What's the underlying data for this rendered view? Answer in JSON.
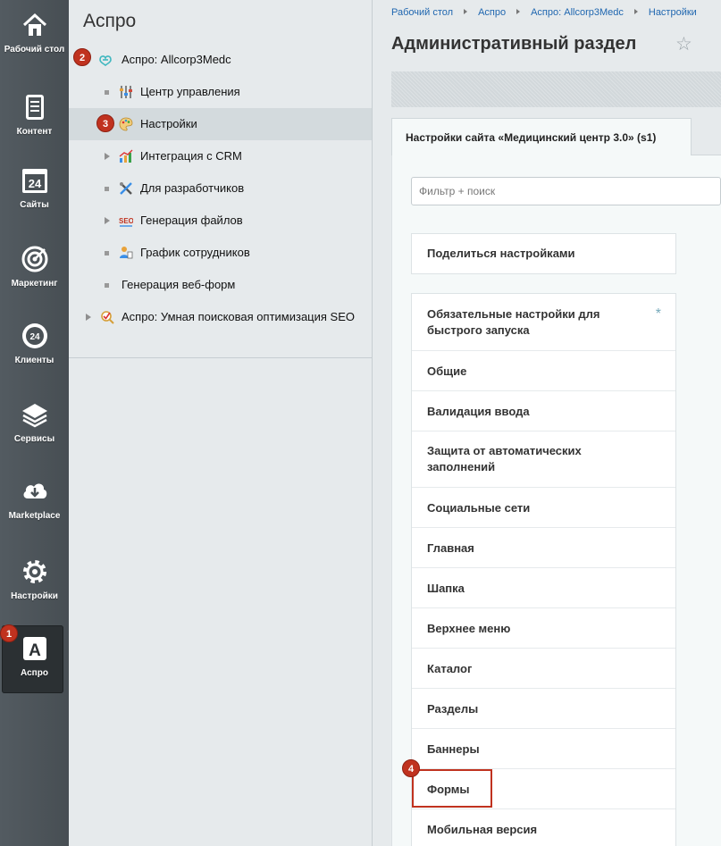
{
  "rail": {
    "items": [
      {
        "label": "Рабочий стол",
        "icon": "home-icon"
      },
      {
        "label": "Контент",
        "icon": "document-icon"
      },
      {
        "label": "Сайты",
        "icon": "calendar-24-icon"
      },
      {
        "label": "Маркетинг",
        "icon": "target-icon"
      },
      {
        "label": "Клиенты",
        "icon": "clients-24-icon"
      },
      {
        "label": "Сервисы",
        "icon": "layers-icon"
      },
      {
        "label": "Marketplace",
        "icon": "cloud-download-icon"
      },
      {
        "label": "Настройки",
        "icon": "gear-icon"
      },
      {
        "label": "Аспро",
        "icon": "aspro-a-icon",
        "active": true
      }
    ]
  },
  "badges": {
    "b1": "1",
    "b2": "2",
    "b3": "3",
    "b4": "4"
  },
  "tree": {
    "title": "Аспро",
    "items": [
      {
        "label": "Аспро: Allcorp3Medc",
        "icon": "heart-link-icon"
      },
      {
        "label": "Центр управления",
        "icon": "sliders-icon"
      },
      {
        "label": "Настройки",
        "icon": "palette-icon",
        "selected": true
      },
      {
        "label": "Интеграция с CRM",
        "icon": "crm-chart-icon"
      },
      {
        "label": "Для разработчиков",
        "icon": "tools-icon"
      },
      {
        "label": "Генерация файлов",
        "icon": "seo-icon"
      },
      {
        "label": "График сотрудников",
        "icon": "employee-schedule-icon"
      },
      {
        "label": "Генерация веб-форм"
      },
      {
        "label": "Аспро: Умная поисковая оптимизация SEO",
        "icon": "magnifier-check-icon"
      }
    ]
  },
  "breadcrumb": [
    "Рабочий стол",
    "Аспро",
    "Аспро: Allcorp3Medc",
    "Настройки"
  ],
  "page_title": "Административный раздел",
  "tab_label": "Настройки сайта «Медицинский центр 3.0» (s1)",
  "filter": {
    "placeholder": "Фильтр + поиск"
  },
  "share_label": "Поделиться настройками",
  "menu": [
    "Обязательные настройки для быстрого запуска",
    "Общие",
    "Валидация ввода",
    "Защита от автоматических заполнений",
    "Социальные сети",
    "Главная",
    "Шапка",
    "Верхнее меню",
    "Каталог",
    "Разделы",
    "Баннеры",
    "Формы",
    "Мобильная версия"
  ],
  "required_mark": "*",
  "colors": {
    "accent": "#c0321f",
    "rail": "#4a5156",
    "link": "#2067b0"
  }
}
